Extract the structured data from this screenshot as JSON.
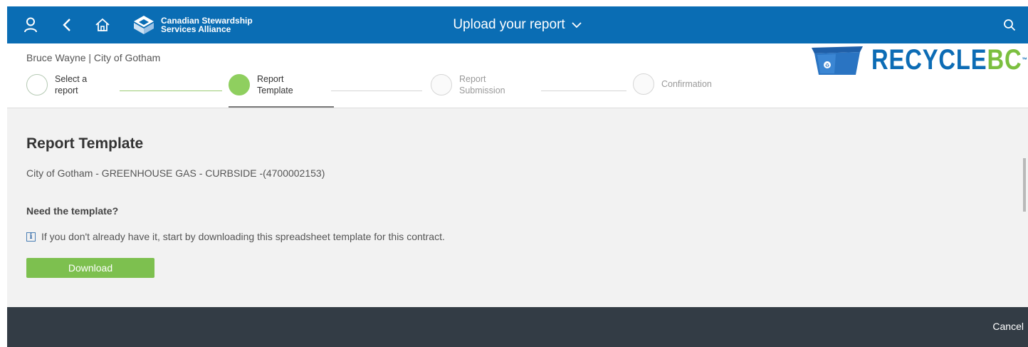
{
  "topbar": {
    "brand_line1": "Canadian Stewardship",
    "brand_line2": "Services Alliance",
    "title": "Upload your report",
    "icons": [
      "user-icon",
      "back-icon",
      "home-icon",
      "chevron-down-icon",
      "search-icon"
    ]
  },
  "header": {
    "user_line": "Bruce Wayne | City of Gotham",
    "steps": [
      {
        "label": "Select a\nreport",
        "state": "incomplete"
      },
      {
        "label": "Report\nTemplate",
        "state": "current"
      },
      {
        "label": "Report\nSubmission",
        "state": "future"
      },
      {
        "label": "Confirmation",
        "state": "future"
      }
    ],
    "logo_part1": "RECYCLE",
    "logo_part2": "BC",
    "logo_tm": "™"
  },
  "main": {
    "section_title": "Report Template",
    "contract": "City of Gotham - GREENHOUSE GAS - CURBSIDE -(4700002153)",
    "need_template": "Need the template?",
    "info_text": "If you don't already have it, start by downloading this spreadsheet template for this contract.",
    "download_label": "Download"
  },
  "footer": {
    "cancel_label": "Cancel"
  },
  "colors": {
    "topbar": "#0a6db4",
    "accent_green": "#7dc04f",
    "footer": "#333c45",
    "background": "#f2f2f2"
  }
}
